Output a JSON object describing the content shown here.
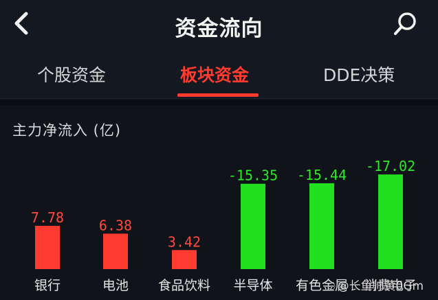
{
  "header": {
    "title": "资金流向"
  },
  "tabs": [
    {
      "label": "个股资金",
      "active": false
    },
    {
      "label": "板块资金",
      "active": true
    },
    {
      "label": "DDE决策",
      "active": false
    }
  ],
  "section": {
    "title": "主力净流入 (亿)"
  },
  "chart_data": {
    "type": "bar",
    "categories": [
      "银行",
      "电池",
      "食品饮料",
      "半导体",
      "有色金属",
      "消费电子"
    ],
    "values": [
      7.78,
      6.38,
      3.42,
      -15.35,
      -15.44,
      -17.02
    ],
    "value_labels": [
      "7.78",
      "6.38",
      "3.42",
      "-15.35",
      "-15.44",
      "-17.02"
    ],
    "unit": "亿",
    "positive_color": "#ff3b30",
    "negative_color": "#22e01f",
    "label_positive_color": "#ff4a3d",
    "label_negative_color": "#2ee82a"
  },
  "watermark": {
    "text": "@长鱼帅黄0Gm"
  },
  "colors": {
    "accent": "#ff3b30",
    "background": "#101319"
  }
}
